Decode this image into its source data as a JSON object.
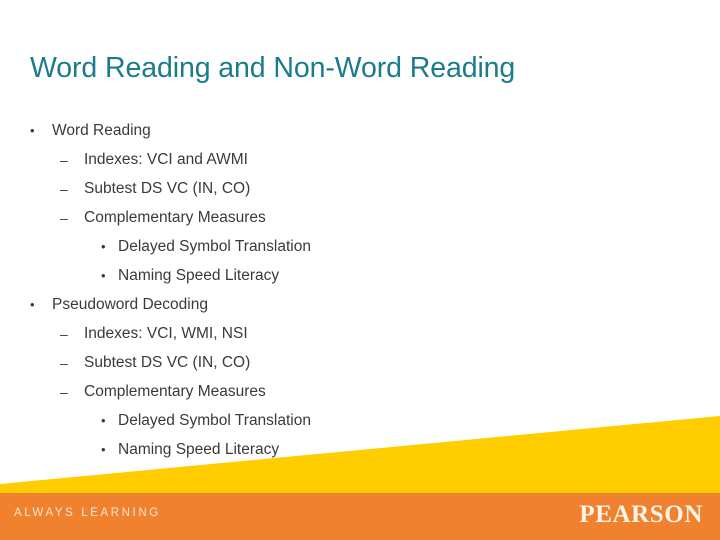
{
  "slide": {
    "title": "Word Reading and Non-Word Reading",
    "background_color": "#FFFFFF",
    "title_color": "#1C7C8C",
    "body_text_color": "#3A3A38",
    "accent_yellow": "#FFCD00",
    "accent_orange": "#F0812F",
    "bullets": [
      {
        "level": 1,
        "marker": "•",
        "text": "Word Reading"
      },
      {
        "level": 2,
        "marker": "–",
        "text": "Indexes: VCI and AWMI"
      },
      {
        "level": 2,
        "marker": "–",
        "text": "Subtest DS VC (IN, CO)"
      },
      {
        "level": 2,
        "marker": "–",
        "text": "Complementary Measures"
      },
      {
        "level": 3,
        "marker": "•",
        "text": "Delayed Symbol Translation"
      },
      {
        "level": 3,
        "marker": "•",
        "text": "Naming Speed Literacy"
      },
      {
        "level": 1,
        "marker": "•",
        "text": "Pseudoword Decoding"
      },
      {
        "level": 2,
        "marker": "–",
        "text": "Indexes: VCI, WMI, NSI"
      },
      {
        "level": 2,
        "marker": "–",
        "text": "Subtest DS VC (IN, CO)"
      },
      {
        "level": 2,
        "marker": "–",
        "text": "Complementary Measures"
      },
      {
        "level": 3,
        "marker": "•",
        "text": "Delayed Symbol Translation"
      },
      {
        "level": 3,
        "marker": "•",
        "text": "Naming Speed Literacy"
      }
    ]
  },
  "footer": {
    "tagline": "ALWAYS LEARNING",
    "brand": "PEARSON",
    "tagline_color": "#FCE6D2",
    "brand_color": "#FDF3E6"
  }
}
